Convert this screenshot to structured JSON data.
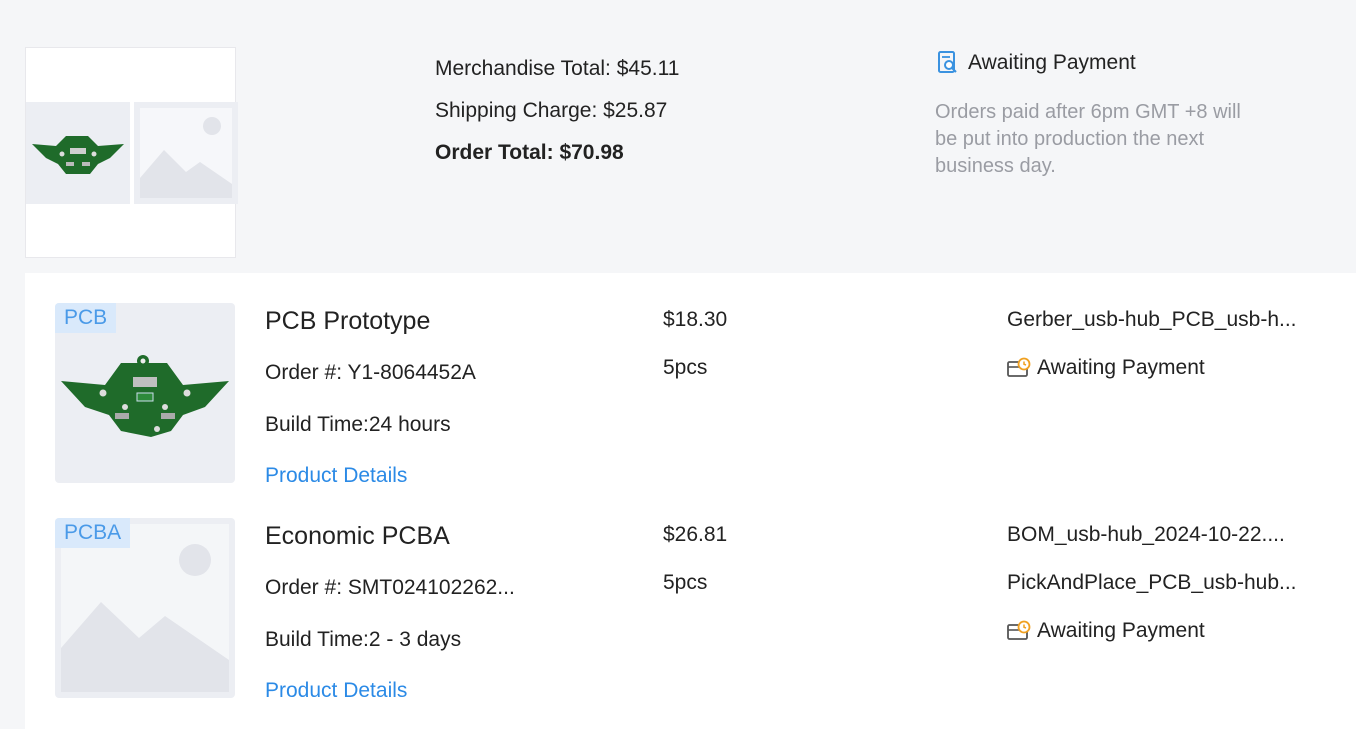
{
  "summary": {
    "merchandise_total": "Merchandise Total: $45.11",
    "shipping_charge": "Shipping Charge: $25.87",
    "order_total": "Order Total: $70.98",
    "status": "Awaiting Payment",
    "status_icon": "search-document-icon",
    "note": "Orders paid after 6pm GMT +8 will be put into production the next business day."
  },
  "items": [
    {
      "tag": "PCB",
      "name": "PCB Prototype",
      "order": "Order #: Y1-8064452A",
      "build_time": "Build Time:24 hours",
      "details_label": "Product Details",
      "price": "$18.30",
      "qty": "5pcs",
      "files": [
        "Gerber_usb-hub_PCB_usb-h..."
      ],
      "status": "Awaiting Payment",
      "status_icon": "wallet-clock-icon"
    },
    {
      "tag": "PCBA",
      "name": "Economic PCBA",
      "order": "Order #: SMT024102262...",
      "build_time": "Build Time:2 - 3 days",
      "details_label": "Product Details",
      "price": "$26.81",
      "qty": "5pcs",
      "files": [
        "BOM_usb-hub_2024-10-22....",
        "PickAndPlace_PCB_usb-hub..."
      ],
      "status": "Awaiting Payment",
      "status_icon": "wallet-clock-icon"
    }
  ],
  "colors": {
    "page_bg": "#f5f6f8",
    "link": "#2b8ae6",
    "tag_bg": "#d9e9fb",
    "tag_text": "#4a9ae8",
    "pcb_green": "#1f6b2a",
    "note_text": "#9a9ca3",
    "status_icon_orange": "#f0a020"
  }
}
